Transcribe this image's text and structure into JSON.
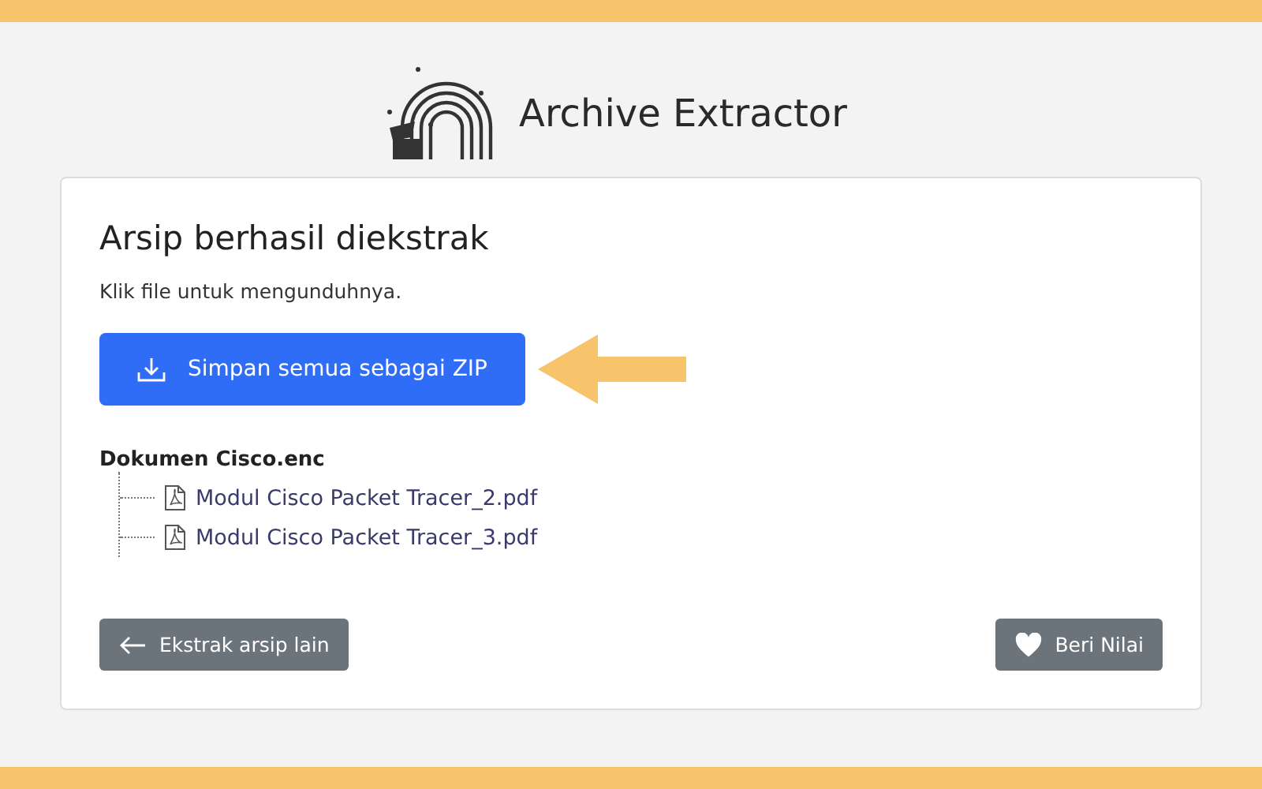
{
  "header": {
    "title": "Archive Extractor"
  },
  "card": {
    "heading": "Arsip berhasil diekstrak",
    "hint": "Klik file untuk mengunduhnya.",
    "save_all_button": "Simpan semua sebagai ZIP",
    "archive": {
      "name": "Dokumen Cisco.enc",
      "children": [
        {
          "name": "Modul Cisco Packet Tracer_2.pdf"
        },
        {
          "name": "Modul Cisco Packet Tracer_3.pdf"
        }
      ]
    },
    "back_button": "Ekstrak arsip lain",
    "rate_button": "Beri Nilai"
  }
}
